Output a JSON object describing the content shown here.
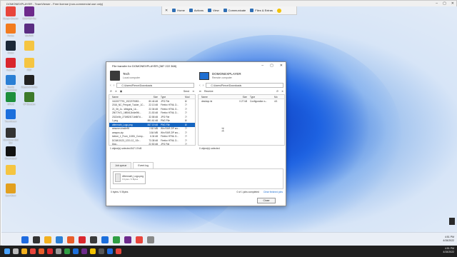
{
  "tv_window": {
    "title": "DOMONEXPLAYER - TeamViewer - Free license (non-commercial use only)"
  },
  "tv_toolbar": {
    "home": "Home",
    "actions": "Actions",
    "view": "View",
    "communicate": "Communicate",
    "files_extras": "Files & Extras"
  },
  "desktop_icons": [
    {
      "label": "Google Chrome",
      "color": "#e8453c"
    },
    {
      "label": "SUM PDF Pro",
      "color": "#6d2a8c"
    },
    {
      "label": "Firefox",
      "color": "#f27b1f"
    },
    {
      "label": "WinRAR",
      "color": "#5a2d82"
    },
    {
      "label": "Steam",
      "color": "#1b2838"
    },
    {
      "label": "",
      "color": "#f5c542"
    },
    {
      "label": "AnyDesk",
      "color": "#d9262e"
    },
    {
      "label": "PDF",
      "color": "#f5c542"
    },
    {
      "label": "Mozilla Thunderbird",
      "color": "#2a7fd4"
    },
    {
      "label": "Ragnarok Online",
      "color": "#222222"
    },
    {
      "label": "GPU Z",
      "color": "#1e8f3c"
    },
    {
      "label": "SP Elevation",
      "color": "#3d7a2a"
    },
    {
      "label": "TeamViewer",
      "color": "#1c6fdc"
    },
    {
      "label": "Sea Dance Dial Bar",
      "color": "#333333"
    },
    {
      "label": "Dead Island",
      "color": "#111111"
    },
    {
      "label": "",
      "color": "#f5c542"
    },
    {
      "label": "Coin Miner",
      "color": "#e2a01f"
    }
  ],
  "file_transfer": {
    "title": "File transfer for DOMONEXPLAYER (387 222 368)",
    "local": {
      "name": "Tech",
      "sub": "Local computer",
      "path": "C:\\Users\\Pierce\\Downloads",
      "send": "Send",
      "headers": [
        "Name",
        "Size",
        "Type",
        "Mod"
      ],
      "rows": [
        {
          "name": "1613077791_1922379083...",
          "size": "80.46 kB",
          "type": "JPG File",
          "mod": "8/"
        },
        {
          "name": "2016_NC_Prequel_Tucker_1C...",
          "size": "22.13 kB",
          "type": "Firefox HTML D...",
          "mod": "7/"
        },
        {
          "name": "21_06_Jo...Widgets_1&...",
          "size": "22.36 kB",
          "type": "Firefox HTML D...",
          "mod": "7/"
        },
        {
          "name": "25077b71_1ff80t12fc6e9f6...",
          "size": "21.53 kB",
          "type": "Firefox HTML D...",
          "mod": "7/"
        },
        {
          "name": "2022e0b_271ff82f171bf6f7d...",
          "size": "32.58 kB",
          "type": "JPG File",
          "mod": "7/"
        },
        {
          "name": "1.png",
          "size": "891.61 kB",
          "type": "PNG File",
          "mod": "8/"
        },
        {
          "name": "aftermath_Logo.png",
          "size": "847.19 kB",
          "type": "PNG File",
          "mod": "8/"
        },
        {
          "name": "amazon-kindle90",
          "size": "2.82 MB",
          "type": "Win RAR ZIP arc...",
          "mod": "7/"
        },
        {
          "name": "amapro-zip",
          "size": "3.84 MB",
          "type": "Win RAR ZIP arc...",
          "mod": "7/"
        },
        {
          "name": "before_1_From_11051_Comp...",
          "size": "6.34 kB",
          "type": "Firefox HTML D...",
          "mod": "7/"
        },
        {
          "name": "DCIM10123_1231.12_1Gr...",
          "size": "73.38 kB",
          "type": "Firefox HTML D...",
          "mod": "7/"
        },
        {
          "name": "Digi...",
          "size": "22.50 kB",
          "type": "JPG File",
          "mod": "7/"
        }
      ],
      "status": "1 object(s) selected   847.19 kB"
    },
    "remote": {
      "name": "DOMONEXPLAYER",
      "sub": "Remote computer",
      "path": "C:\\Users\\Pierce\\Downloads",
      "receive": "Receive",
      "headers": [
        "Name",
        "Size",
        "Type",
        "Mo"
      ],
      "rows": [
        {
          "name": "desktop.ini",
          "size": "0.27 kB",
          "type": "Configuration s...",
          "mod": "4/1"
        }
      ],
      "status": "0 object(s) selected"
    },
    "tabs": [
      "Job queue",
      "Event log"
    ],
    "event_item": {
      "file": "Aftermath_Logo.png",
      "info": "0 bytes / 0 Bytes"
    },
    "progress": "0 bytes / 0 Bytes",
    "jobs_completed": "0 of 1 jobs completed",
    "clear_finished": "Clear finished jobs",
    "close": "Close"
  },
  "remote_taskbar": {
    "time": "4:51 PM",
    "date": "4/15/2022"
  },
  "local_taskbar": {
    "time": "4:51 PM",
    "date": "4/15/2022"
  }
}
